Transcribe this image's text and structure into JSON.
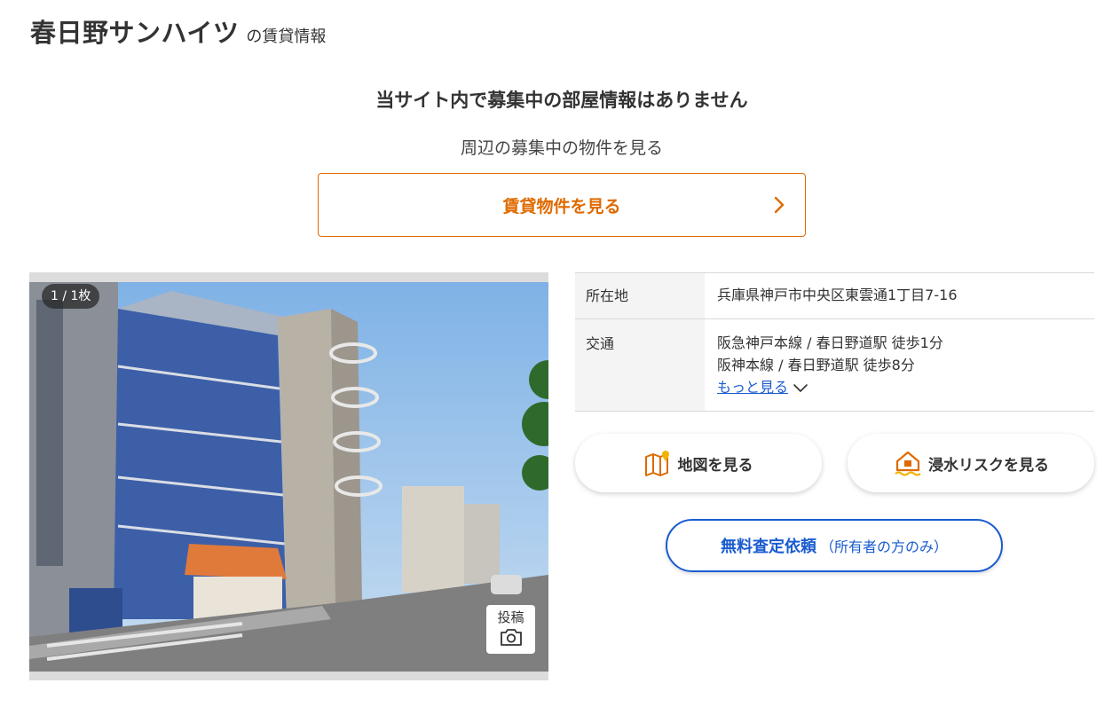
{
  "header": {
    "building_name": "春日野サンハイツ",
    "subtitle": "の賃貸情報"
  },
  "notice": {
    "no_rooms": "当サイト内で募集中の部屋情報はありません",
    "nearby": "周辺の募集中の物件を見る",
    "rental_button": "賃貸物件を見る"
  },
  "gallery": {
    "counter": "1 / 1枚",
    "post_label": "投稿"
  },
  "info": {
    "address_label": "所在地",
    "address_value": "兵庫県神戸市中央区東雲通1丁目7-16",
    "access_label": "交通",
    "access_lines": [
      "阪急神戸本線 / 春日野道駅 徒歩1分",
      "阪神本線 / 春日野道駅 徒歩8分"
    ],
    "more_label": "もっと見る"
  },
  "actions": {
    "map_label": "地図を見る",
    "flood_label": "浸水リスクを見る",
    "assess_main": "無料査定依頼",
    "assess_note": "（所有者の方のみ）"
  },
  "colors": {
    "accent_orange": "#e06a00",
    "link_blue": "#1a5ccf"
  },
  "icons": [
    "chevron-right-icon",
    "camera-icon",
    "map-icon",
    "house-flood-icon",
    "chevron-down-icon"
  ]
}
